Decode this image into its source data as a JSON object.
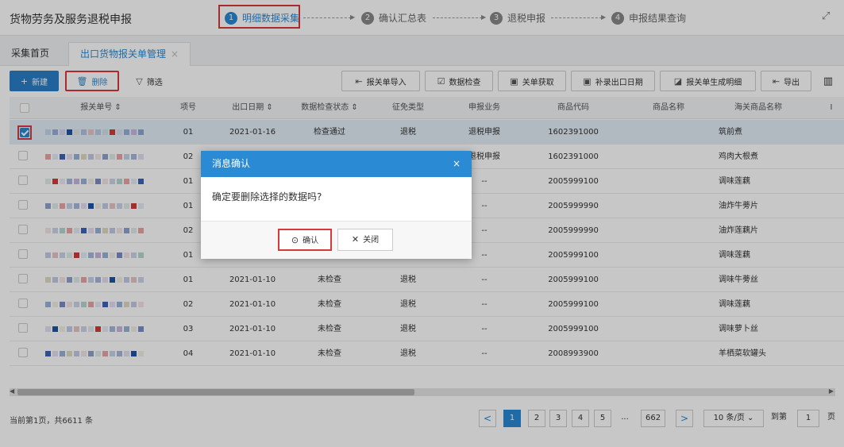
{
  "header": {
    "title": "货物劳务及服务退税申报",
    "steps": [
      {
        "num": "1",
        "label": "明细数据采集",
        "active": true
      },
      {
        "num": "2",
        "label": "确认汇总表",
        "active": false
      },
      {
        "num": "3",
        "label": "退税申报",
        "active": false
      },
      {
        "num": "4",
        "label": "申报结果查询",
        "active": false
      }
    ]
  },
  "tabs": {
    "home": "采集首页",
    "current": "出口货物报关单管理",
    "close_symbol": "×"
  },
  "toolbar": {
    "new_label": "新建",
    "delete_label": "删除",
    "filter_label": "筛选",
    "import_label": "报关单导入",
    "check_label": "数据检查",
    "fetch_label": "关单获取",
    "supplement_label": "补录出口日期",
    "generate_label": "报关单生成明细",
    "export_label": "导出"
  },
  "table": {
    "columns": [
      "报关单号",
      "项号",
      "出口日期",
      "数据检查状态",
      "征免类型",
      "申报业务",
      "商品代码",
      "商品名称",
      "海关商品名称",
      "I"
    ],
    "sort_symbol": "⇕",
    "rows": [
      {
        "item": "01",
        "date": "2021-01-16",
        "status": "检查通过",
        "type": "退税",
        "business": "退税申报",
        "code": "1602391000",
        "name": "",
        "customs_name": "筑前煮",
        "checked": true
      },
      {
        "item": "02",
        "date": "",
        "status": "",
        "type": "",
        "business": "退税申报",
        "code": "1602391000",
        "name": "",
        "customs_name": "鸡肉大根煮",
        "checked": false
      },
      {
        "item": "01",
        "date": "",
        "status": "",
        "type": "",
        "business": "--",
        "code": "2005999100",
        "name": "",
        "customs_name": "调味莲藕",
        "checked": false
      },
      {
        "item": "01",
        "date": "",
        "status": "",
        "type": "",
        "business": "--",
        "code": "2005999990",
        "name": "",
        "customs_name": "油炸牛蒡片",
        "checked": false
      },
      {
        "item": "02",
        "date": "",
        "status": "",
        "type": "",
        "business": "--",
        "code": "2005999990",
        "name": "",
        "customs_name": "油炸莲藕片",
        "checked": false
      },
      {
        "item": "01",
        "date": "",
        "status": "",
        "type": "",
        "business": "--",
        "code": "2005999100",
        "name": "",
        "customs_name": "调味莲藕",
        "checked": false
      },
      {
        "item": "01",
        "date": "2021-01-10",
        "status": "未检查",
        "type": "退税",
        "business": "--",
        "code": "2005999100",
        "name": "",
        "customs_name": "调味牛蒡丝",
        "checked": false
      },
      {
        "item": "02",
        "date": "2021-01-10",
        "status": "未检查",
        "type": "退税",
        "business": "--",
        "code": "2005999100",
        "name": "",
        "customs_name": "调味莲藕",
        "checked": false
      },
      {
        "item": "03",
        "date": "2021-01-10",
        "status": "未检查",
        "type": "退税",
        "business": "--",
        "code": "2005999100",
        "name": "",
        "customs_name": "调味萝卜丝",
        "checked": false
      },
      {
        "item": "04",
        "date": "2021-01-10",
        "status": "未检查",
        "type": "退税",
        "business": "--",
        "code": "2008993900",
        "name": "",
        "customs_name": "羊栖菜软罐头",
        "checked": false
      }
    ]
  },
  "pagination": {
    "info": "当前第1页，共6611 条",
    "pages": [
      "1",
      "2",
      "3",
      "4",
      "5"
    ],
    "ellipsis": "...",
    "last_page": "662",
    "prev": "<",
    "next": ">",
    "page_size": "10 条/页",
    "goto_label": "到第",
    "goto_value": "1",
    "page_suffix": "页"
  },
  "modal": {
    "title": "消息确认",
    "message": "确定要删除选择的数据吗?",
    "confirm_label": "确认",
    "close_label": "关闭",
    "close_symbol": "×"
  },
  "colors": {
    "accent": "#2a8ad4",
    "highlight": "#d9383a"
  }
}
